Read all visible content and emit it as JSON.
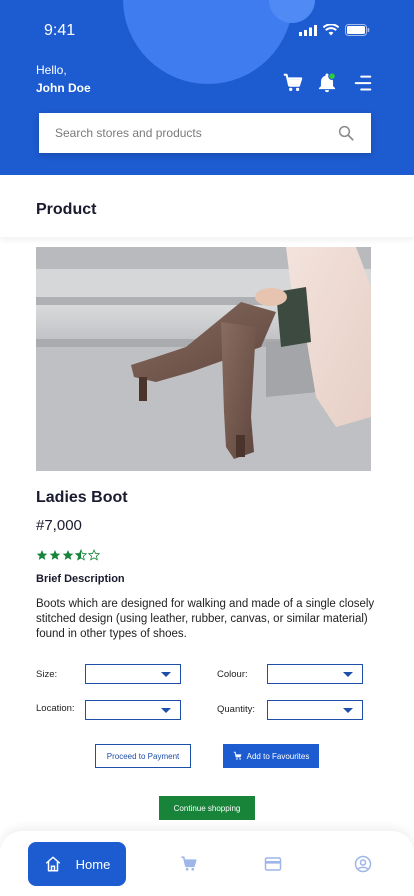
{
  "status": {
    "time": "9:41"
  },
  "header": {
    "greeting": "Hello,",
    "user_name": "John Doe",
    "search_placeholder": "Search stores and products"
  },
  "page": {
    "title": "Product"
  },
  "product": {
    "name": "Ladies Boot",
    "price": "#7,000",
    "rating": 3.5,
    "rating_max": 5,
    "description_title": "Brief Description",
    "description": "Boots which are designed for walking and made of a single closely stitched design (using leather, rubber, canvas, or similar material) found in other types of shoes."
  },
  "options": {
    "size_label": "Size:",
    "colour_label": "Colour:",
    "location_label": "Location:",
    "quantity_label": "Quantity:"
  },
  "actions": {
    "proceed_label": "Proceed to Payment",
    "favourites_label": "Add to Favourites",
    "continue_label": "Continue shopping"
  },
  "nav": {
    "home_label": "Home",
    "items": [
      "cart-icon",
      "card-icon",
      "profile-icon"
    ]
  },
  "colors": {
    "primary": "#1d5bd0",
    "accent_green": "#17843a",
    "notification_dot": "#2ecc40"
  }
}
